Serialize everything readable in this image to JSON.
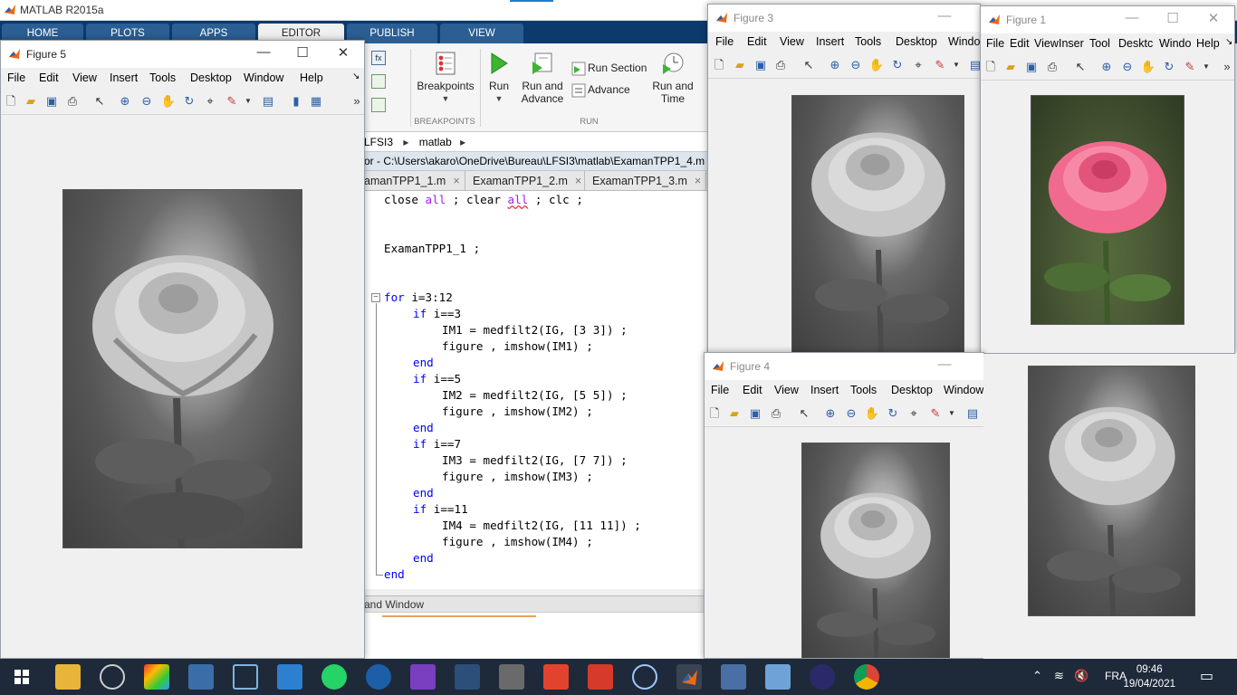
{
  "app": {
    "title": "MATLAB R2015a"
  },
  "ribbon": {
    "tabs": [
      "HOME",
      "PLOTS",
      "APPS",
      "EDITOR",
      "PUBLISH",
      "VIEW"
    ],
    "active_tab": "EDITOR",
    "buttons": {
      "breakpoints": "Breakpoints",
      "run": "Run",
      "run_advance_1": "Run and",
      "run_advance_2": "Advance",
      "run_section": "Run Section",
      "advance": "Advance",
      "run_time_1": "Run and",
      "run_time_2": "Time"
    },
    "groups": {
      "breakpoints": "BREAKPOINTS",
      "run": "RUN"
    }
  },
  "path": {
    "crumb1": "LFSI3",
    "crumb2": "matlab"
  },
  "editor": {
    "title": "or - C:\\Users\\akaro\\OneDrive\\Bureau\\LFSI3\\matlab\\ExamanTPP1_4.m",
    "tabs": [
      "amanTPP1_1.m",
      "ExamanTPP1_2.m",
      "ExamanTPP1_3.m"
    ],
    "tab_close": "×",
    "code": {
      "l1_a": "close ",
      "l1_b": "all",
      "l1_c": " ; clear ",
      "l1_d": "all",
      "l1_e": " ; clc ;",
      "l2": "ExamanTPP1_1 ;",
      "l3_kw": "for",
      "l3": " i=3:12",
      "l4_kw": "if",
      "l4": " i==3",
      "l5": "IM1 = medfilt2(IG, [3 3]) ;",
      "l6": "figure , imshow(IM1) ;",
      "l7_kw": "end",
      "l8_kw": "if",
      "l8": " i==5",
      "l9": "IM2 = medfilt2(IG, [5 5]) ;",
      "l10": "figure , imshow(IM2) ;",
      "l11_kw": "end",
      "l12_kw": "if",
      "l12": " i==7",
      "l13": "IM3 = medfilt2(IG, [7 7]) ;",
      "l14": "figure , imshow(IM3) ;",
      "l15_kw": "end",
      "l16_kw": "if",
      "l16": " i==11",
      "l17": "IM4 = medfilt2(IG, [11 11]) ;",
      "l18": "figure , imshow(IM4) ;",
      "l19_kw": "end",
      "l20_kw": "end"
    }
  },
  "command_window": {
    "title": "and Window"
  },
  "figures": {
    "fig5": {
      "title": "Figure 5",
      "menu": [
        "File",
        "Edit",
        "View",
        "Insert",
        "Tools",
        "Desktop",
        "Window",
        "Help"
      ]
    },
    "fig3": {
      "title": "Figure 3",
      "menu": [
        "File",
        "Edit",
        "View",
        "Insert",
        "Tools",
        "Desktop",
        "Windo"
      ]
    },
    "fig1": {
      "title": "Figure 1",
      "menu": [
        "File",
        "Edit",
        "View",
        "Inser",
        "Tool",
        "Desktc",
        "Windo",
        "Help"
      ]
    },
    "fig4": {
      "title": "Figure 4",
      "menu": [
        "File",
        "Edit",
        "View",
        "Insert",
        "Tools",
        "Desktop",
        "Window"
      ]
    }
  },
  "taskbar": {
    "lang": "FRA",
    "time": "09:46",
    "date": "19/04/2021"
  },
  "colors": {
    "ribbon_tab_bar": "#0d3a6c",
    "taskbar": "#1e2a3a",
    "keyword": "#0000ff",
    "string": "#a020f0",
    "rose_pink": "#f06a8e"
  },
  "icons": [
    "matlab-logo-icon",
    "run-icon",
    "breakpoints-icon",
    "run-advance-icon",
    "run-section-icon",
    "advance-icon",
    "run-time-icon",
    "zoom-in-icon",
    "zoom-out-icon",
    "pan-icon",
    "rotate-icon",
    "data-cursor-icon",
    "brush-icon",
    "new-file-icon",
    "open-file-icon",
    "save-icon",
    "print-icon",
    "pointer-icon",
    "windows-start-icon",
    "chrome-icon"
  ]
}
